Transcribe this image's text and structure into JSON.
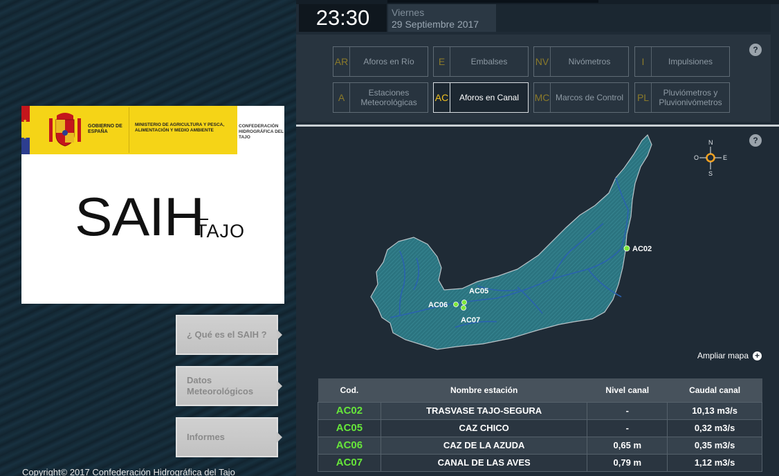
{
  "logo": {
    "gov_label": "GOBIERNO DE ESPAÑA",
    "ministry_label": "MINISTERIO DE AGRICULTURA Y PESCA, ALIMENTACIÓN Y MEDIO AMBIENTE",
    "cht_label": "CONFEDERACIÓN HIDROGRÁFICA DEL TAJO",
    "saih": "SAIH",
    "tajo": "TAJO"
  },
  "sidebar": {
    "buttons": [
      {
        "label": "¿ Qué es el SAIH ?"
      },
      {
        "label": "Datos Meteorológicos"
      },
      {
        "label": "Informes"
      }
    ]
  },
  "copyright": "Copyright© 2017 Confederación Hidrográfica del Tajo",
  "clock": {
    "time": "23:30",
    "weekday": "Viernes",
    "date": "29 Septiembre 2017"
  },
  "categories": [
    {
      "code": "AR",
      "label": "Aforos en Río",
      "active": false
    },
    {
      "code": "E",
      "label": "Embalses",
      "active": false
    },
    {
      "code": "NV",
      "label": "Nivómetros",
      "active": false
    },
    {
      "code": "I",
      "label": "Impulsiones",
      "active": false
    },
    {
      "code": "A",
      "label": "Estaciones Meteorológicas",
      "active": false
    },
    {
      "code": "AC",
      "label": "Aforos en Canal",
      "active": true
    },
    {
      "code": "MC",
      "label": "Marcos de Control",
      "active": false
    },
    {
      "code": "PL",
      "label": "Pluviómetros y Pluvionivómetros",
      "active": false
    }
  ],
  "help_symbol": "?",
  "compass": {
    "n": "N",
    "s": "S",
    "e": "E",
    "o": "O"
  },
  "map": {
    "stations": [
      "AC02",
      "AC05",
      "AC06",
      "AC07"
    ],
    "expand_label": "Ampliar mapa",
    "expand_symbol": "+"
  },
  "table": {
    "headers": [
      "Cod.",
      "Nombre estación",
      "Nivel canal",
      "Caudal canal"
    ],
    "rows": [
      {
        "cod": "AC02",
        "name": "TRASVASE TAJO-SEGURA",
        "nivel": "-",
        "caudal": "10,13 m3/s"
      },
      {
        "cod": "AC05",
        "name": "CAZ CHICO",
        "nivel": "-",
        "caudal": "0,32 m3/s"
      },
      {
        "cod": "AC06",
        "name": "CAZ DE LA AZUDA",
        "nivel": "0,65 m",
        "caudal": "0,35 m3/s"
      },
      {
        "cod": "AC07",
        "name": "CANAL DE LAS AVES",
        "nivel": "0,79 m",
        "caudal": "1,12 m3/s"
      }
    ]
  },
  "colors": {
    "station_dot": "#7ee83a",
    "basin_fill": "#2e7a86",
    "active_code": "#f0c020",
    "code_green": "#66e63a"
  }
}
